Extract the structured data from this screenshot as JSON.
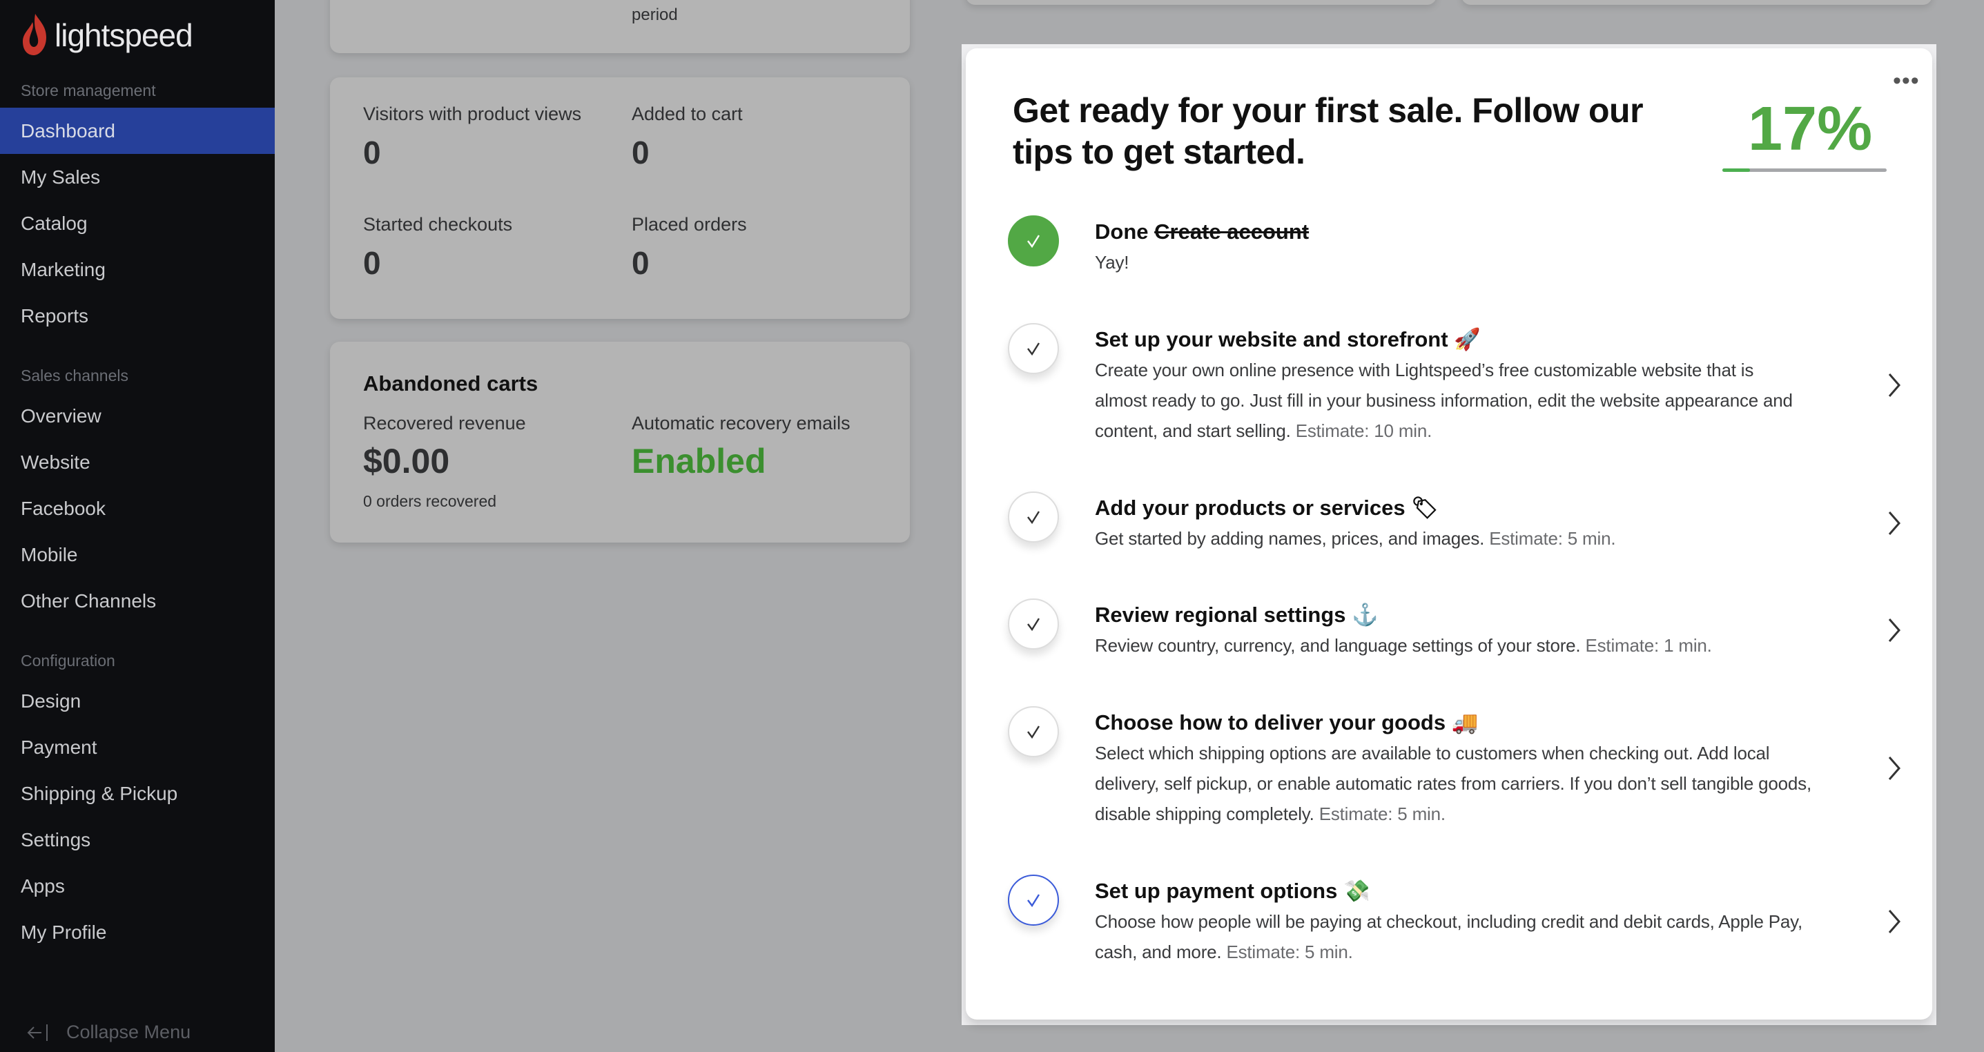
{
  "sidebar": {
    "logo": "lightspeed",
    "sections": [
      {
        "header": "Store management",
        "items": [
          "Dashboard",
          "My Sales",
          "Catalog",
          "Marketing",
          "Reports"
        ]
      },
      {
        "header": "Sales channels",
        "items": [
          "Overview",
          "Website",
          "Facebook",
          "Mobile",
          "Other Channels"
        ]
      },
      {
        "header": "Configuration",
        "items": [
          "Design",
          "Payment",
          "Shipping & Pickup",
          "Settings",
          "Apps",
          "My Profile"
        ]
      }
    ],
    "active": "Dashboard",
    "collapse_label": "Collapse Menu",
    "colors": {
      "background": "#0d0e11",
      "active": "#26409a"
    }
  },
  "top_card": {
    "period_label": "period"
  },
  "funnel": {
    "visitors_label": "Visitors with product views",
    "visitors_value": "0",
    "cart_label": "Added to cart",
    "cart_value": "0",
    "checkouts_label": "Started checkouts",
    "checkouts_value": "0",
    "orders_label": "Placed orders",
    "orders_value": "0"
  },
  "abandoned": {
    "title": "Abandoned carts",
    "revenue_label": "Recovered revenue",
    "revenue_value": "$0.00",
    "orders_recovered": "0 orders recovered",
    "emails_label": "Automatic recovery emails",
    "emails_value": "Enabled",
    "enabled_color": "#3b8f2f"
  },
  "onboarding": {
    "title": "Get ready for your first sale. Follow our tips to get started.",
    "progress_label": "17%",
    "progress": 17,
    "menu_icon": "more-horizontal-icon",
    "accent": "#52a845",
    "items": [
      {
        "status": "done",
        "done_prefix": "Done",
        "title": "Create account",
        "lines": [
          "Yay!"
        ],
        "estimate": ""
      },
      {
        "status": "todo",
        "title": "Set up your website and storefront",
        "emoji": "🚀",
        "lines": [
          "Create your own online presence with Lightspeed’s free customizable website that is",
          "almost ready to go. Just fill in your business information, edit the website appearance and",
          "content, and start selling."
        ],
        "estimate": "Estimate: 10 min."
      },
      {
        "status": "todo",
        "title": "Add your products or services",
        "emoji": "🏷",
        "lines": [
          "Get started by adding names, prices, and images."
        ],
        "estimate": "Estimate: 5 min."
      },
      {
        "status": "todo",
        "title": "Review regional settings",
        "emoji": "⚓",
        "lines": [
          "Review country, currency, and language settings of your store."
        ],
        "estimate": "Estimate: 1 min."
      },
      {
        "status": "todo",
        "title": "Choose how to deliver your goods",
        "emoji": "🚚",
        "lines": [
          "Select which shipping options are available to customers when checking out. Add local",
          "delivery, self pickup, or enable automatic rates from carriers. If you don’t sell tangible goods,",
          "disable shipping completely."
        ],
        "estimate": "Estimate: 5 min."
      },
      {
        "status": "current",
        "title": "Set up payment options",
        "emoji": "💸",
        "lines": [
          "Choose how people will be paying at checkout, including credit and debit cards, Apple Pay,",
          "cash, and more."
        ],
        "estimate": "Estimate: 5 min."
      }
    ]
  }
}
